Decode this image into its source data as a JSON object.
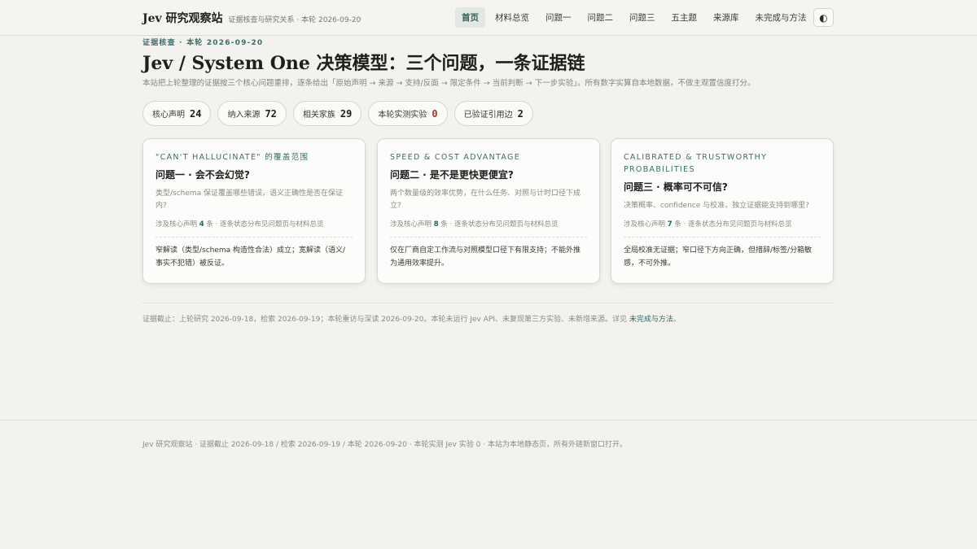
{
  "header": {
    "brand_title": "Jev 研究观察站",
    "brand_subtitle": "证据核查与研究关系 · 本轮 2026-09-20",
    "nav": [
      {
        "label": "首页",
        "active": true
      },
      {
        "label": "材料总览",
        "active": false
      },
      {
        "label": "问题一",
        "active": false
      },
      {
        "label": "问题二",
        "active": false
      },
      {
        "label": "问题三",
        "active": false
      },
      {
        "label": "五主题",
        "active": false
      },
      {
        "label": "来源库",
        "active": false
      },
      {
        "label": "未完成与方法",
        "active": false
      }
    ],
    "theme_toggle_glyph": "◐"
  },
  "hero": {
    "kicker": "证据核查 · 本轮 2026-09-20",
    "title": "Jev / System One 决策模型：三个问题，一条证据链",
    "lead": "本站把上轮整理的证据按三个核心问题重排，逐条给出「原始声明 → 来源 → 支持/反面 → 限定条件 → 当前判断 → 下一步实验」。所有数字实算自本地数据，不做主观置信度打分。"
  },
  "stats": [
    {
      "label": "核心声明",
      "value": "24"
    },
    {
      "label": "纳入来源",
      "value": "72"
    },
    {
      "label": "相关家族",
      "value": "29"
    },
    {
      "label": "本轮实测实验",
      "value": "0"
    },
    {
      "label": "已验证引用边",
      "value": "2"
    }
  ],
  "cards": [
    {
      "kicker": "\"CAN'T HALLUCINATE\" 的覆盖范围",
      "title": "问题一 · 会不会幻觉?",
      "desc": "类型/schema 保证覆盖哪些错误，语义正确性是否在保证内?",
      "meta_prefix": "涉及核心声明",
      "meta_count": "4",
      "meta_suffix": "条 · 逐条状态分布见问题页与材料总览",
      "verdict": "窄解读（类型/schema 构造性合法）成立；宽解读（语义/事实不犯错）被反证。"
    },
    {
      "kicker": "SPEED & COST ADVANTAGE",
      "title": "问题二 · 是不是更快更便宜?",
      "desc": "两个数量级的效率优势，在什么任务、对照与计时口径下成立?",
      "meta_prefix": "涉及核心声明",
      "meta_count": "8",
      "meta_suffix": "条 · 逐条状态分布见问题页与材料总览",
      "verdict": "仅在厂商自定工作流与对照模型口径下有限支持；不能外推为通用效率提升。"
    },
    {
      "kicker": "CALIBRATED & TRUSTWORTHY PROBABILITIES",
      "title": "问题三 · 概率可不可信?",
      "desc": "决策概率、confidence 与校准，独立证据能支持到哪里?",
      "meta_prefix": "涉及核心声明",
      "meta_count": "7",
      "meta_suffix": "条 · 逐条状态分布见问题页与材料总览",
      "verdict": "全局校准无证据；窄口径下方向正确，但措辞/标签/分箱敏感，不可外推。"
    }
  ],
  "evidence_note": {
    "text": "证据截止：上轮研究 2026-09-18，检索 2026-09-19；本轮重访与深读 2026-09-20。本轮未运行 Jev API、未复现第三方实验、未新增来源。详见",
    "link": "未完成与方法",
    "end": "。"
  },
  "footer": {
    "text": "Jev 研究观察站 · 证据截止 2026-09-18 / 检索 2026-09-19 / 本轮 2026-09-20 · 本轮实测 Jev 实验 0 · 本站为本地静态页，所有外链新窗口打开。"
  }
}
